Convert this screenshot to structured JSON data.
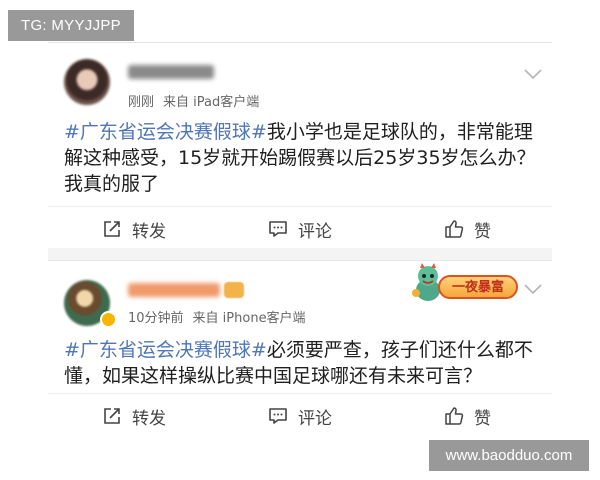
{
  "watermarks": {
    "telegram": "TG: MYYJJPP",
    "site": "www.baodduo.com"
  },
  "posts": [
    {
      "meta": {
        "time": "刚刚",
        "source": "来自 iPad客户端"
      },
      "hashtag": "#广东省运会决赛假球#",
      "body": "我小学也是足球队的，非常能理解这种感受，15岁就开始踢假赛以后25岁35岁怎么办？我真的服了",
      "actions": {
        "repost": "转发",
        "comment": "评论",
        "like": "赞"
      }
    },
    {
      "meta": {
        "time": "10分钟前",
        "source": "来自 iPhone客户端"
      },
      "sticker_text": "一夜暴富",
      "hashtag": "#广东省运会决赛假球#",
      "body": "必须要严查，孩子们还什么都不懂，如果这样操纵比赛中国足球哪还有未来可言？",
      "actions": {
        "repost": "转发",
        "comment": "评论",
        "like": "赞"
      }
    }
  ],
  "icons": {
    "repost": "repost-icon",
    "comment": "comment-icon",
    "like": "thumbs-up-icon",
    "menu": "chevron-down-icon"
  },
  "colors": {
    "hashtag": "#4f76b6",
    "meta_text": "#666666",
    "watermark_bg": "#999999"
  }
}
